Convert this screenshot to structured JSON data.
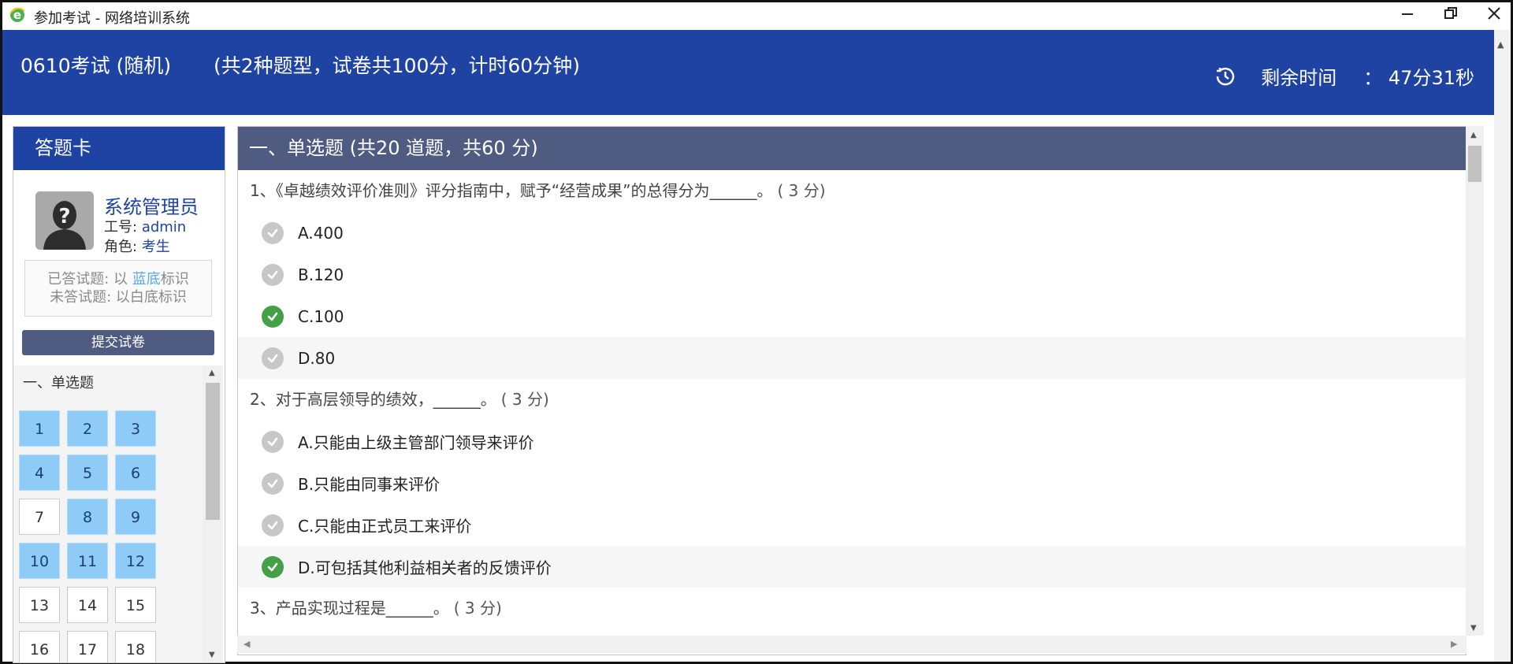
{
  "window": {
    "title": "参加考试 - 网络培训系统",
    "app_icon": "ie-browser-icon",
    "minimize_icon": "minimize-icon",
    "restore_icon": "restore-icon",
    "close_icon": "close-icon"
  },
  "header": {
    "exam_title": "0610考试 (随机)",
    "exam_info": "(共2种题型，试卷共100分，计时60分钟)",
    "timer_icon": "clock-history-icon",
    "timer_label": "剩余时间",
    "timer_value": "：  47分31秒"
  },
  "answer_card": {
    "title": "答题卡",
    "avatar_icon": "unknown-user-avatar-icon",
    "user_name": "系统管理员",
    "id_label": "工号:",
    "id_value": "admin",
    "role_label": "角色:",
    "role_value": "考生",
    "legend_answered_prefix": "已答试题:  以 ",
    "legend_answered_highlight": "蓝底",
    "legend_answered_suffix": "标识",
    "legend_unanswered": "未答试题:  以白底标识",
    "submit_label": "提交试卷",
    "section_label": "一、单选题",
    "questions": [
      {
        "num": "1",
        "answered": true
      },
      {
        "num": "2",
        "answered": true
      },
      {
        "num": "3",
        "answered": true
      },
      {
        "num": "4",
        "answered": true
      },
      {
        "num": "5",
        "answered": true
      },
      {
        "num": "6",
        "answered": true
      },
      {
        "num": "7",
        "answered": false
      },
      {
        "num": "8",
        "answered": true
      },
      {
        "num": "9",
        "answered": true
      },
      {
        "num": "10",
        "answered": true
      },
      {
        "num": "11",
        "answered": true
      },
      {
        "num": "12",
        "answered": true
      },
      {
        "num": "13",
        "answered": false
      },
      {
        "num": "14",
        "answered": false
      },
      {
        "num": "15",
        "answered": false
      },
      {
        "num": "16",
        "answered": false
      },
      {
        "num": "17",
        "answered": false
      },
      {
        "num": "18",
        "answered": false
      }
    ]
  },
  "main": {
    "section_title": "一、单选题 (共20 道题，共60 分)",
    "questions": [
      {
        "text": "1、《卓越绩效评价准则》评分指南中，赋予“经营成果”的总得分为______。",
        "points": "( 3 分)",
        "options": [
          {
            "label": "A.400",
            "selected": false
          },
          {
            "label": "B.120",
            "selected": false
          },
          {
            "label": "C.100",
            "selected": true
          },
          {
            "label": "D.80",
            "selected": false
          }
        ]
      },
      {
        "text": "2、对于高层领导的绩效，______。",
        "points": "( 3 分)",
        "options": [
          {
            "label": "A.只能由上级主管部门领导来评价",
            "selected": false
          },
          {
            "label": "B.只能由同事来评价",
            "selected": false
          },
          {
            "label": "C.只能由正式员工来评价",
            "selected": false
          },
          {
            "label": "D.可包括其他利益相关者的反馈评价",
            "selected": true
          }
        ]
      },
      {
        "text": "3、产品实现过程是______。",
        "points": "( 3 分)",
        "options": []
      }
    ]
  },
  "colors": {
    "header_blue": "#1f43a3",
    "section_slate": "#4f5b81",
    "answered_blue": "#8ecbf7",
    "check_green": "#43a047",
    "check_grey": "#c7c7c7"
  }
}
